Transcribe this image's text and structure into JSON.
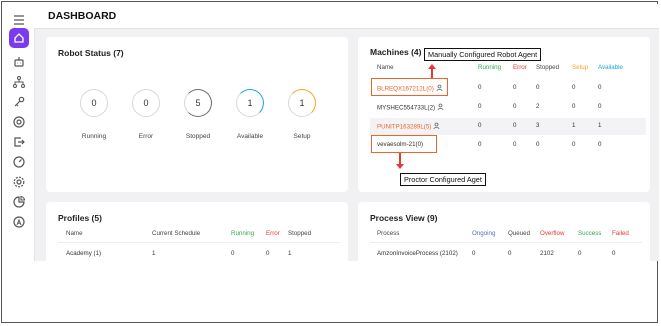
{
  "header": {
    "title": "DASHBOARD"
  },
  "sidebar": {
    "icons": [
      "menu-icon",
      "home-icon",
      "robot-icon",
      "hierarchy-icon",
      "key-icon",
      "target-icon",
      "export-icon",
      "gauge-icon",
      "settings-icon",
      "analytics-icon",
      "user-circle-icon"
    ],
    "active": "home-icon"
  },
  "robot_status": {
    "title": "Robot Status (7)",
    "items": [
      {
        "label": "Running",
        "value": "0"
      },
      {
        "label": "Error",
        "value": "0"
      },
      {
        "label": "Stopped",
        "value": "5"
      },
      {
        "label": "Available",
        "value": "1"
      },
      {
        "label": "Setup",
        "value": "1"
      }
    ]
  },
  "machines": {
    "title": "Machines (4)",
    "columns": {
      "name": "Name",
      "running": "Running",
      "error": "Error",
      "stopped": "Stopped",
      "setup": "Setup",
      "available": "Available"
    },
    "rows": [
      {
        "name": "BLREQX167212L(0)",
        "running": "0",
        "error": "0",
        "stopped": "0",
        "setup": "0",
        "available": "0"
      },
      {
        "name": "MYSHEC554733L(2)",
        "running": "0",
        "error": "0",
        "stopped": "2",
        "setup": "0",
        "available": "0"
      },
      {
        "name": "PUNITP163289L(5)",
        "running": "0",
        "error": "0",
        "stopped": "3",
        "setup": "1",
        "available": "1"
      },
      {
        "name": "vevaesolm-21(0)",
        "running": "0",
        "error": "0",
        "stopped": "0",
        "setup": "0",
        "available": "0"
      }
    ]
  },
  "annotations": {
    "manual": "Manually Configured Robot Agent",
    "proctor": "Proctor Configured Aget"
  },
  "profiles": {
    "title": "Profiles (5)",
    "columns": {
      "name": "Name",
      "schedule": "Current Schedule",
      "running": "Running",
      "error": "Error",
      "stopped": "Stopped"
    },
    "rows": [
      {
        "name": "Academy (1)",
        "schedule": "1",
        "running": "0",
        "error": "0",
        "stopped": "1"
      }
    ]
  },
  "process_view": {
    "title": "Process View (9)",
    "columns": {
      "process": "Process",
      "ongoing": "Ongoing",
      "queued": "Queued",
      "overflow": "Overflow",
      "success": "Success",
      "failed": "Failed"
    },
    "rows": [
      {
        "process": "AmzonInvoiceProcess (2102)",
        "ongoing": "0",
        "queued": "0",
        "overflow": "2102",
        "success": "0",
        "failed": "0"
      }
    ]
  },
  "colors": {
    "accent": "#7c3aed",
    "running": "#2fa84f",
    "error": "#e53935",
    "setup": "#f5a623",
    "available": "#1aa7d9",
    "link": "#e8672c"
  }
}
